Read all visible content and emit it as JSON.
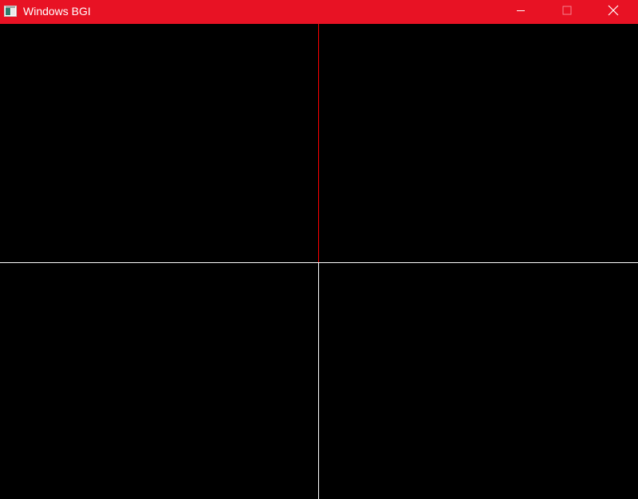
{
  "window": {
    "title": "Windows BGI",
    "titlebar_color": "#e81224",
    "title_color": "#ffffff"
  },
  "icons": {
    "app": "bgi-app-icon",
    "minimize": "minimize-icon",
    "maximize": "maximize-icon",
    "close": "close-icon"
  },
  "canvas": {
    "background": "#000000",
    "lines": [
      {
        "name": "vertical-axis-upper",
        "color": "#ff0000"
      },
      {
        "name": "horizontal-axis",
        "color": "#ffffff"
      },
      {
        "name": "vertical-axis-lower",
        "color": "#ffffff"
      }
    ]
  }
}
